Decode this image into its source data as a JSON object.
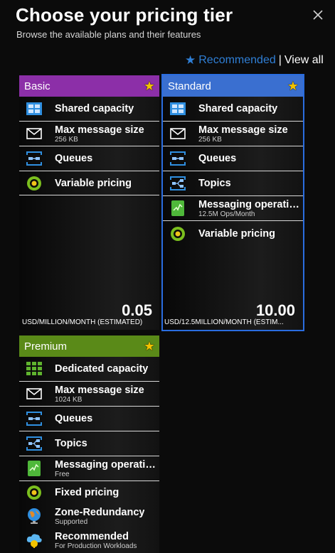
{
  "header": {
    "title": "Choose your pricing tier",
    "subtitle": "Browse the available plans and their features",
    "recommended_label": "Recommended",
    "separator": "|",
    "view_all_label": "View all"
  },
  "colors": {
    "basic_header": "#8c2fa8",
    "standard_header": "#3a6fd0",
    "standard_border": "#2a6de0",
    "premium_header": "#5a8a18",
    "link": "#2f7fd6",
    "star": "#f2c200"
  },
  "tiers": {
    "basic": {
      "name": "Basic",
      "features": [
        {
          "icon": "shared-capacity-icon",
          "title": "Shared capacity",
          "detail": ""
        },
        {
          "icon": "envelope-icon",
          "title": "Max message size",
          "detail": "256 KB"
        },
        {
          "icon": "queues-icon",
          "title": "Queues",
          "detail": ""
        },
        {
          "icon": "variable-pricing-icon",
          "title": "Variable pricing",
          "detail": ""
        }
      ],
      "price": "0.05",
      "unit": "USD/MILLION/MONTH (ESTIMATED)"
    },
    "standard": {
      "name": "Standard",
      "features": [
        {
          "icon": "shared-capacity-icon",
          "title": "Shared capacity",
          "detail": ""
        },
        {
          "icon": "envelope-icon",
          "title": "Max message size",
          "detail": "256 KB"
        },
        {
          "icon": "queues-icon",
          "title": "Queues",
          "detail": ""
        },
        {
          "icon": "topics-icon",
          "title": "Topics",
          "detail": ""
        },
        {
          "icon": "messaging-operations-icon",
          "title": "Messaging operatio...",
          "detail": "12.5M Ops/Month"
        },
        {
          "icon": "variable-pricing-icon",
          "title": "Variable pricing",
          "detail": ""
        }
      ],
      "price": "10.00",
      "unit": "USD/12.5MILLION/MONTH (ESTIM..."
    },
    "premium": {
      "name": "Premium",
      "features": [
        {
          "icon": "dedicated-capacity-icon",
          "title": "Dedicated capacity",
          "detail": ""
        },
        {
          "icon": "envelope-icon",
          "title": "Max message size",
          "detail": "1024 KB"
        },
        {
          "icon": "queues-icon",
          "title": "Queues",
          "detail": ""
        },
        {
          "icon": "topics-icon",
          "title": "Topics",
          "detail": ""
        },
        {
          "icon": "messaging-operations-icon",
          "title": "Messaging operatio...",
          "detail": "Free"
        },
        {
          "icon": "fixed-pricing-icon",
          "title": "Fixed pricing",
          "detail": ""
        },
        {
          "icon": "globe-icon",
          "title": "Zone-Redundancy",
          "detail": "Supported"
        },
        {
          "icon": "cloud-recommended-icon",
          "title": "Recommended",
          "detail": "For Production Workloads"
        }
      ]
    }
  }
}
